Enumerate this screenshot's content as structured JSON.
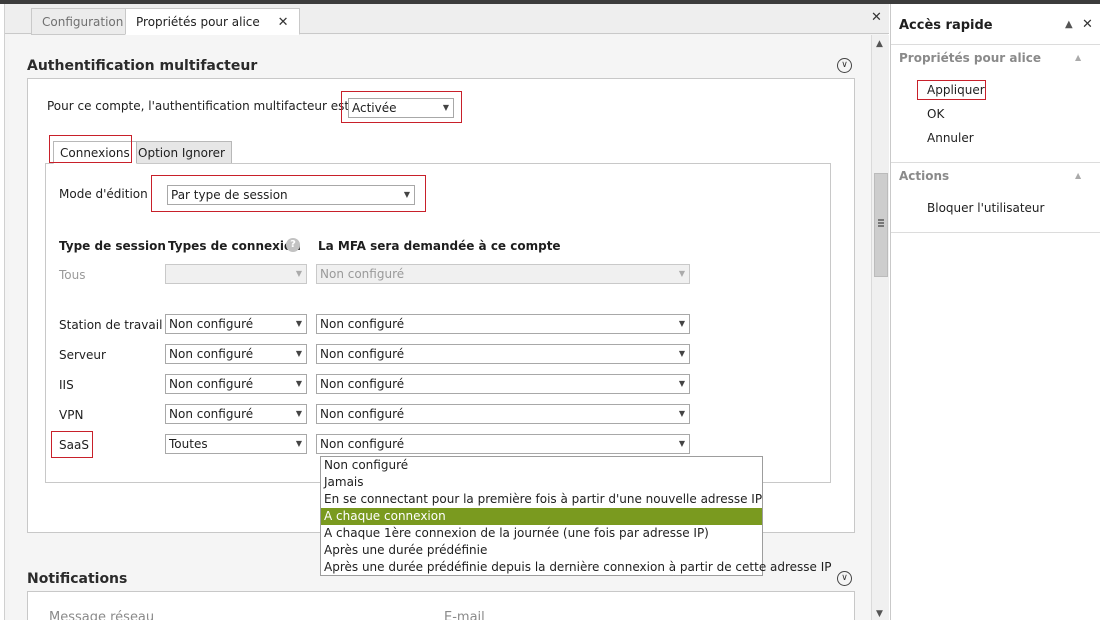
{
  "doc_tabs": [
    {
      "label": "Configuration"
    },
    {
      "label": "Propriétés pour alice"
    }
  ],
  "close_glyph": "✕",
  "mfa": {
    "title": "Authentification multifacteur",
    "account_label": "Pour ce compte, l'authentification multifacteur est",
    "status_value": "Activée",
    "inner_tabs": [
      "Connexions",
      "Option Ignorer"
    ],
    "edit_mode_label": "Mode d'édition",
    "edit_mode_value": "Par type de session",
    "headers": {
      "session_type": "Type de session",
      "connection_types": "Types de connexion",
      "mfa_required": "La MFA sera demandée à ce compte"
    },
    "all_row": {
      "label": "Tous",
      "types": "",
      "mfa": "Non configuré"
    },
    "rows": [
      {
        "label": "Station de travail",
        "types": "Non configuré",
        "mfa": "Non configuré"
      },
      {
        "label": "Serveur",
        "types": "Non configuré",
        "mfa": "Non configuré"
      },
      {
        "label": "IIS",
        "types": "Non configuré",
        "mfa": "Non configuré"
      },
      {
        "label": "VPN",
        "types": "Non configuré",
        "mfa": "Non configuré"
      },
      {
        "label": "SaaS",
        "types": "Toutes",
        "mfa": "Non configuré"
      }
    ],
    "dropdown_options": [
      "Non configuré",
      "Jamais",
      "En se connectant pour la première fois à partir d'une nouvelle adresse IP",
      "A chaque connexion",
      "A chaque 1ère connexion de la journée (une fois par adresse IP)",
      "Après une durée prédéfinie",
      "Après une durée prédéfinie depuis la dernière connexion à partir de cette adresse IP"
    ],
    "dropdown_selected_index": 3
  },
  "notifications": {
    "title": "Notifications",
    "col_left": "Message réseau",
    "col_right": "E-mail"
  },
  "side": {
    "title": "Accès rapide",
    "groups": [
      {
        "title": "Propriétés pour alice",
        "actions": [
          "Appliquer",
          "OK",
          "Annuler"
        ]
      },
      {
        "title": "Actions",
        "actions": [
          "Bloquer l'utilisateur"
        ]
      }
    ]
  },
  "colors": {
    "highlight": "#c8202a",
    "selected": "#7a9a1f"
  }
}
